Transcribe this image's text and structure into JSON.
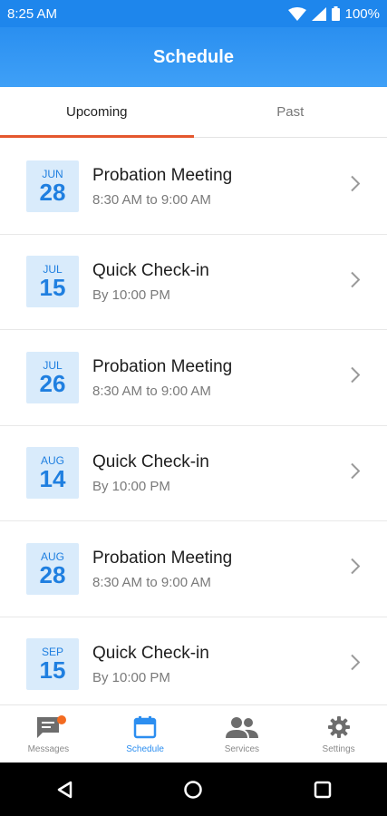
{
  "status_bar": {
    "time": "8:25 AM",
    "battery": "100%"
  },
  "app_bar": {
    "title": "Schedule"
  },
  "tabs": [
    {
      "label": "Upcoming",
      "active": true
    },
    {
      "label": "Past",
      "active": false
    }
  ],
  "schedule": [
    {
      "month": "JUN",
      "day": "28",
      "title": "Probation Meeting",
      "time": "8:30 AM to 9:00 AM"
    },
    {
      "month": "JUL",
      "day": "15",
      "title": "Quick Check-in",
      "time": "By 10:00 PM"
    },
    {
      "month": "JUL",
      "day": "26",
      "title": "Probation Meeting",
      "time": "8:30 AM to 9:00 AM"
    },
    {
      "month": "AUG",
      "day": "14",
      "title": "Quick Check-in",
      "time": "By 10:00 PM"
    },
    {
      "month": "AUG",
      "day": "28",
      "title": "Probation Meeting",
      "time": "8:30 AM to 9:00 AM"
    },
    {
      "month": "SEP",
      "day": "15",
      "title": "Quick Check-in",
      "time": "By 10:00 PM"
    }
  ],
  "bottom_nav": [
    {
      "label": "Messages",
      "icon": "message-icon",
      "active": false,
      "has_badge": true
    },
    {
      "label": "Schedule",
      "icon": "calendar-icon",
      "active": true,
      "has_badge": false
    },
    {
      "label": "Services",
      "icon": "people-icon",
      "active": false,
      "has_badge": false
    },
    {
      "label": "Settings",
      "icon": "gear-icon",
      "active": false,
      "has_badge": false
    }
  ],
  "colors": {
    "primary": "#2a8ff0",
    "tab_indicator": "#e4572e",
    "date_badge_bg": "#d9ebfb",
    "date_text": "#1f7fe0",
    "notification_dot": "#f36b21"
  }
}
